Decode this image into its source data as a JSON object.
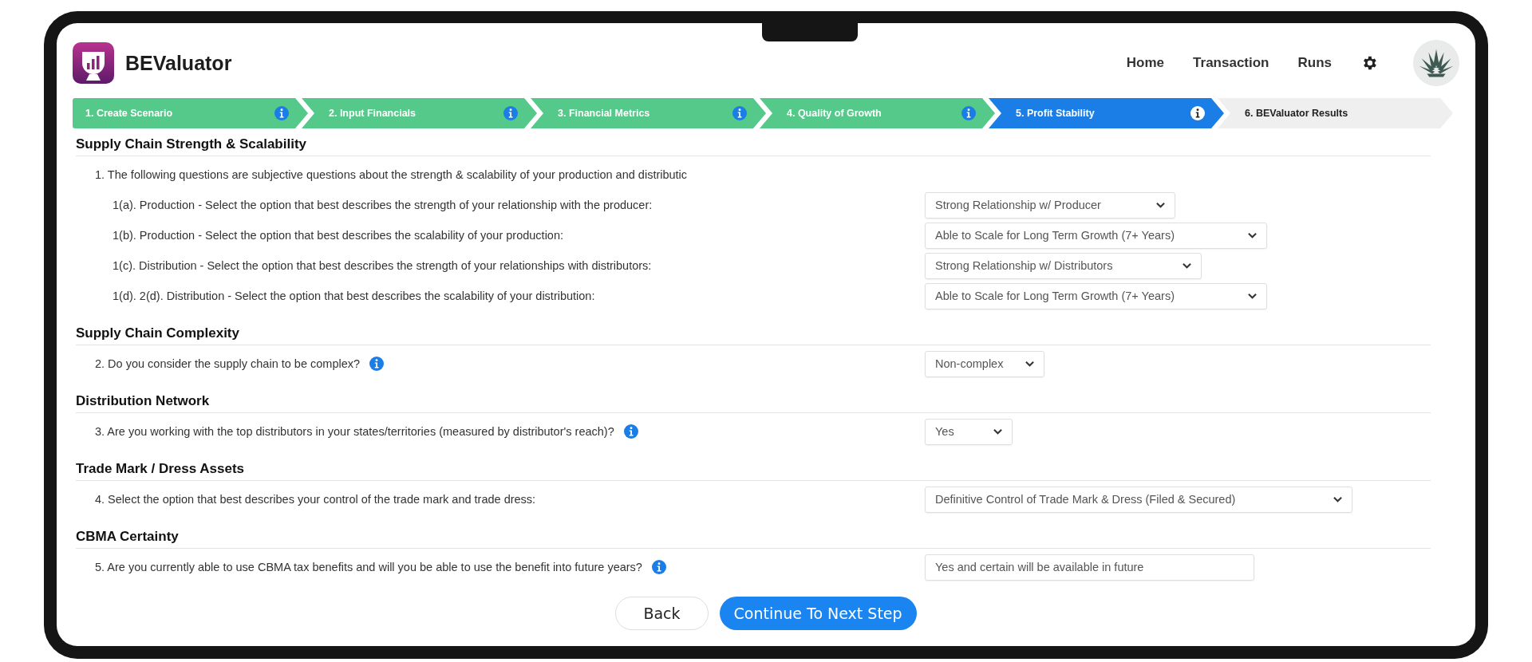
{
  "app": {
    "name": "BEValuator"
  },
  "nav": [
    {
      "label": "Home"
    },
    {
      "label": "Transaction"
    },
    {
      "label": "Runs"
    }
  ],
  "steps": [
    {
      "label": "1. Create Scenario",
      "completed": true,
      "selected": false,
      "info": true
    },
    {
      "label": "2. Input Financials",
      "completed": true,
      "selected": false,
      "info": true
    },
    {
      "label": "3. Financial Metrics",
      "completed": true,
      "selected": false,
      "info": true
    },
    {
      "label": "4. Quality of Growth",
      "completed": true,
      "selected": false,
      "info": true
    },
    {
      "label": "5. Profit Stability",
      "completed": false,
      "selected": true,
      "info": true
    },
    {
      "label": "6. BEValuator Results",
      "completed": false,
      "selected": false,
      "info": false
    }
  ],
  "sections": [
    {
      "title": "Supply Chain Strength & Scalability",
      "questions": [
        {
          "kind": "intro",
          "text": "1. The following questions are subjective questions about the strength & scalability of your production and distributic",
          "info": false,
          "children": [
            {
              "kind": "select",
              "text": "1(a). Production - Select the option that best describes the strength of your relationship with the producer:",
              "info": false,
              "value": "Strong Relationship w/ Producer",
              "caret": true
            },
            {
              "kind": "select",
              "text": "1(b). Production - Select the option that best describes the scalability of your production:",
              "info": false,
              "value": "Able to Scale for Long Term Growth (7+ Years)",
              "caret": true
            },
            {
              "kind": "select",
              "text": "1(c). Distribution - Select the option that best describes the strength of your relationships with distributors:",
              "info": false,
              "value": "Strong Relationship w/ Distributors",
              "caret": true
            },
            {
              "kind": "select",
              "text": "1(d). 2(d). Distribution - Select the option that best describes the scalability of your distribution:",
              "info": false,
              "value": "Able to Scale for Long Term Growth (7+ Years)",
              "caret": true
            }
          ]
        }
      ]
    },
    {
      "title": "Supply Chain Complexity",
      "questions": [
        {
          "kind": "select",
          "text": "2. Do you consider the supply chain to be complex?",
          "info": true,
          "value": "Non-complex",
          "caret": true
        }
      ]
    },
    {
      "title": "Distribution Network",
      "questions": [
        {
          "kind": "select",
          "text": "3. Are you working with the top distributors in your states/territories (measured by distributor's reach)?",
          "info": true,
          "value": "Yes",
          "caret": true
        }
      ]
    },
    {
      "title": "Trade Mark / Dress Assets",
      "questions": [
        {
          "kind": "select",
          "text": "4. Select the option that best describes your control of the trade mark and trade dress:",
          "info": false,
          "value": "Definitive Control of Trade Mark & Dress (Filed & Secured)",
          "caret": true
        }
      ]
    },
    {
      "title": "CBMA Certainty",
      "questions": [
        {
          "kind": "select",
          "text": "5. Are you currently able to use CBMA tax benefits and will you be able to use the benefit into future years?",
          "info": true,
          "value": "Yes and certain will be available in future",
          "caret": false
        }
      ]
    }
  ],
  "buttons": [
    {
      "label": "Back",
      "kind": "secondary"
    },
    {
      "label": "Continue To Next Step",
      "kind": "primary"
    }
  ]
}
